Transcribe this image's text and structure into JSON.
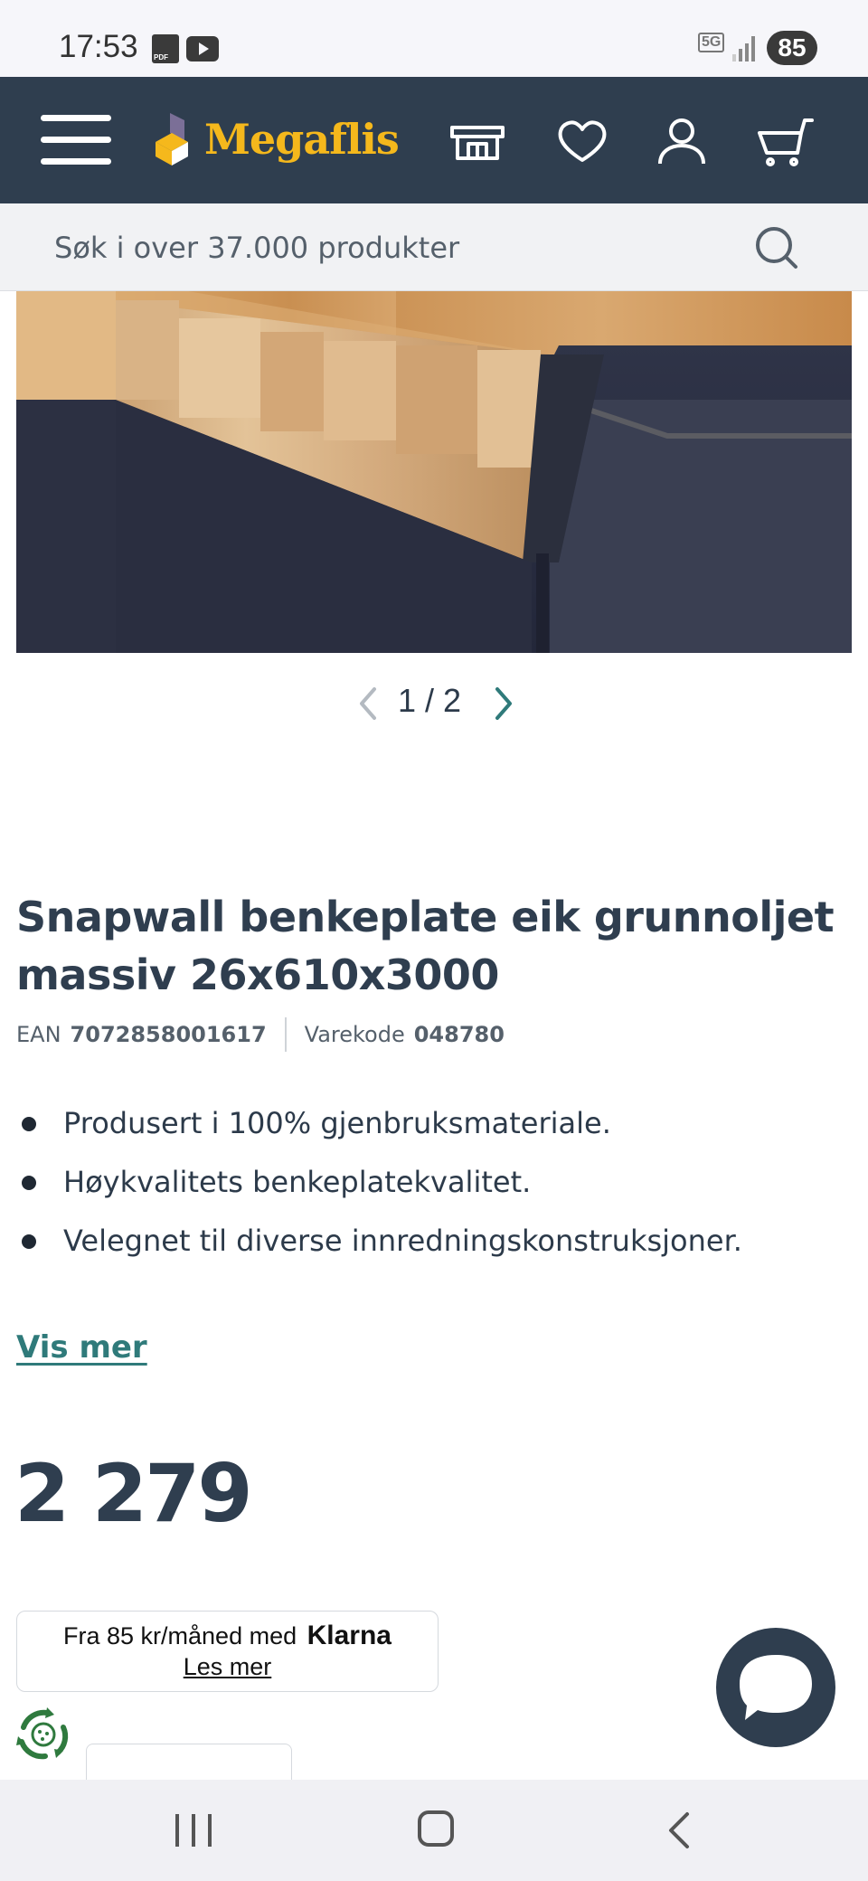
{
  "status_bar": {
    "time": "17:53",
    "network": "5G",
    "battery": "85"
  },
  "header": {
    "logo_text": "Megaflis"
  },
  "search": {
    "placeholder": "Søk i over 37.000 produkter"
  },
  "gallery": {
    "current": "1",
    "total": "2",
    "pager_text": "1 / 2"
  },
  "product": {
    "title": "Snapwall benkeplate eik grunnoljet massiv 26x610x3000",
    "ean_label": "EAN",
    "ean_value": "7072858001617",
    "code_label": "Varekode",
    "code_value": "048780",
    "features": [
      "Produsert i 100% gjenbruksmateriale.",
      "Høykvalitets benkeplatekvalitet.",
      "Velegnet til diverse innredningskonstruksjoner."
    ],
    "more_link": "Vis mer",
    "price": "2 279"
  },
  "klarna": {
    "text": "Fra 85 kr/måned med",
    "brand": "Klarna",
    "link": "Les mer"
  },
  "colors": {
    "header_bg": "#2f3e4f",
    "logo_accent": "#f5b81c",
    "link": "#2f7a7a"
  }
}
